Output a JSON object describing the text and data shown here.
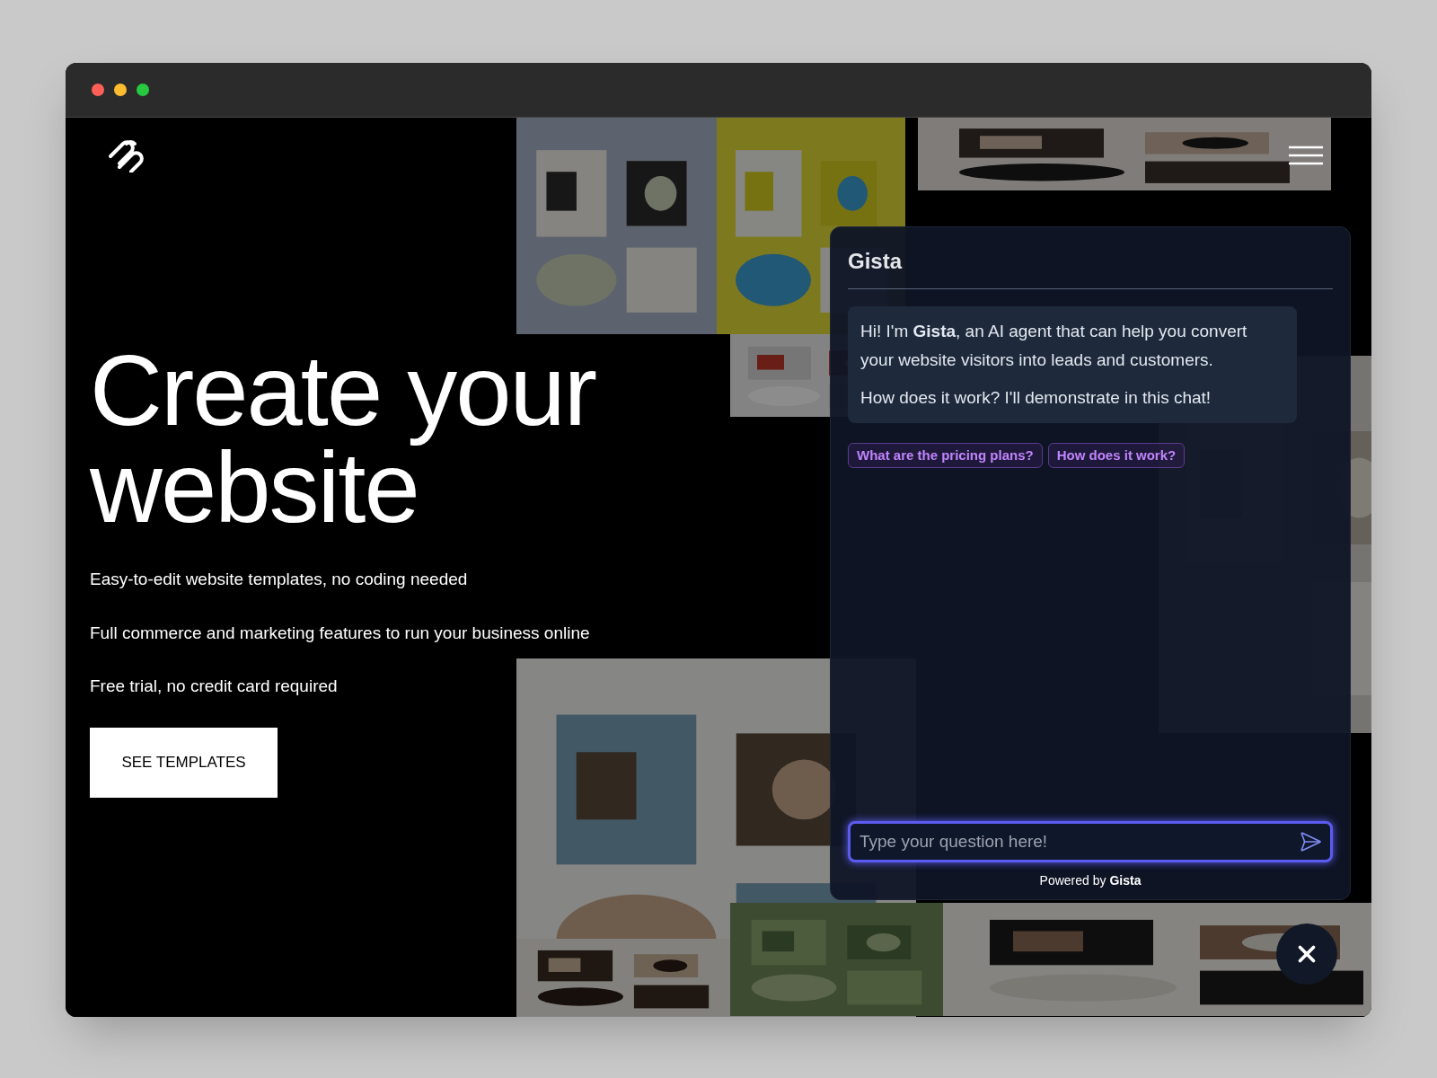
{
  "window": {
    "controls": [
      {
        "color": "#fe5f57"
      },
      {
        "color": "#febc2e"
      },
      {
        "color": "#28c840"
      }
    ]
  },
  "site": {
    "headline": "Create your website",
    "features": [
      "Easy-to-edit website templates, no coding needed",
      "Full commerce and marketing features to run your business online",
      "Free trial, no credit card required"
    ],
    "cta": "SEE TEMPLATES"
  },
  "chat": {
    "title": "Gista",
    "messages": [
      {
        "text": "Hi! I'm **Gista**, an AI agent that can help you convert your website visitors into leads and customers."
      },
      {
        "text": "How does it work? I'll demonstrate in this chat!"
      }
    ],
    "suggestions": [
      "What are the pricing plans?",
      "How does it work?"
    ],
    "input": {
      "placeholder": "Type your question here!"
    },
    "footer": "Powered by **Gista**"
  }
}
